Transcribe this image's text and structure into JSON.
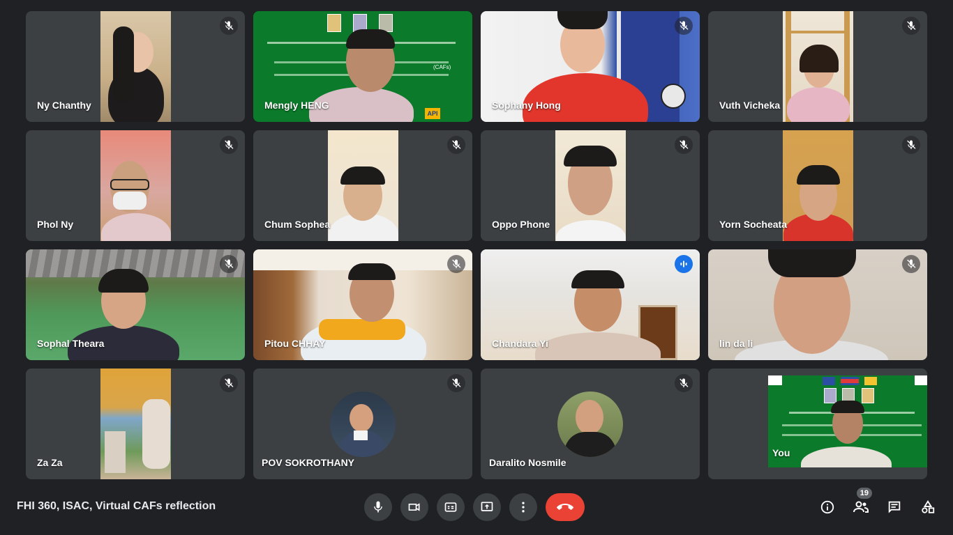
{
  "participants": [
    {
      "name": "Ny Chanthy",
      "muted": true
    },
    {
      "name": "Mengly HENG",
      "muted": false
    },
    {
      "name": "Sophany Hong",
      "muted": true
    },
    {
      "name": "Vuth Vicheka",
      "muted": true
    },
    {
      "name": "Phol Ny",
      "muted": true
    },
    {
      "name": "Chum Sophea",
      "muted": true
    },
    {
      "name": "Oppo Phone",
      "muted": true
    },
    {
      "name": "Yorn Socheata",
      "muted": true
    },
    {
      "name": "Sophal Theara",
      "muted": true
    },
    {
      "name": "Pitou CHHAY",
      "muted": true
    },
    {
      "name": "Chandara Yi",
      "muted": false,
      "speaking": true
    },
    {
      "name": "lin da li",
      "muted": true
    },
    {
      "name": "Za Za",
      "muted": true
    },
    {
      "name": "POV SOKROTHANY",
      "muted": true
    },
    {
      "name": "Daralito Nosmile",
      "muted": true
    },
    {
      "name": "You",
      "muted": false
    }
  ],
  "meeting": {
    "title": "FHI 360, ISAC, Virtual CAFs reflection",
    "participant_count": "19"
  },
  "slide": {
    "tag": "(CAFs)",
    "logo": "API"
  },
  "colors": {
    "background": "#202124",
    "tile": "#3c4043",
    "end_call": "#ea4335",
    "speaking": "#1a73e8",
    "slide_green": "#0b7a2a"
  },
  "icons": {
    "mic": "mic-icon",
    "camera": "camera-icon",
    "captions": "captions-icon",
    "present": "present-icon",
    "more": "more-vert-icon",
    "end": "end-call-icon",
    "info": "info-icon",
    "people": "people-icon",
    "chat": "chat-icon",
    "activities": "activities-icon"
  }
}
